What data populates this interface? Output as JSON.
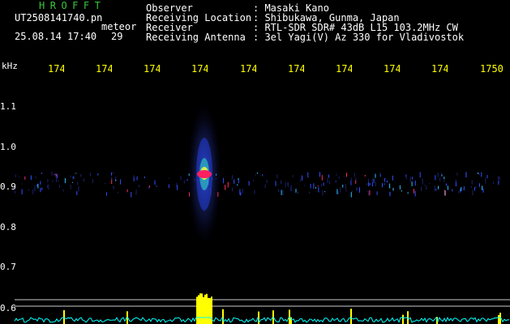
{
  "header": {
    "brand": "HROFFT",
    "filename": "UT2508141740.pn",
    "datetime": "25.08.14 17:40",
    "type": "meteor",
    "count": "29"
  },
  "info": [
    {
      "key": "Observer",
      "value": ": Masaki Kano"
    },
    {
      "key": "Receiving Location",
      "value": ": Shibukawa, Gunma, Japan"
    },
    {
      "key": "Receiver",
      "value": ": RTL-SDR SDR# 43dB L15 103.2MHz CW"
    },
    {
      "key": "Receiving Antenna",
      "value": ": 3el Yagi(V) Az 330 for Vladivostok"
    }
  ],
  "axis": {
    "unit": "kHz",
    "time_labels": [
      "174",
      "174",
      "174",
      "174",
      "174",
      "174",
      "174",
      "174",
      "174",
      "1750"
    ],
    "freq_labels": [
      "1.1",
      "1.0",
      "0.9",
      "0.8",
      "0.7",
      "0.6"
    ]
  },
  "colors": {
    "background": "#000000",
    "brand": "#38c838",
    "time_labels": "#ffff00",
    "spectrum_fill": "#ffff00",
    "spectrum_line": "#00ffff",
    "signal_core": "#ff2060"
  }
}
